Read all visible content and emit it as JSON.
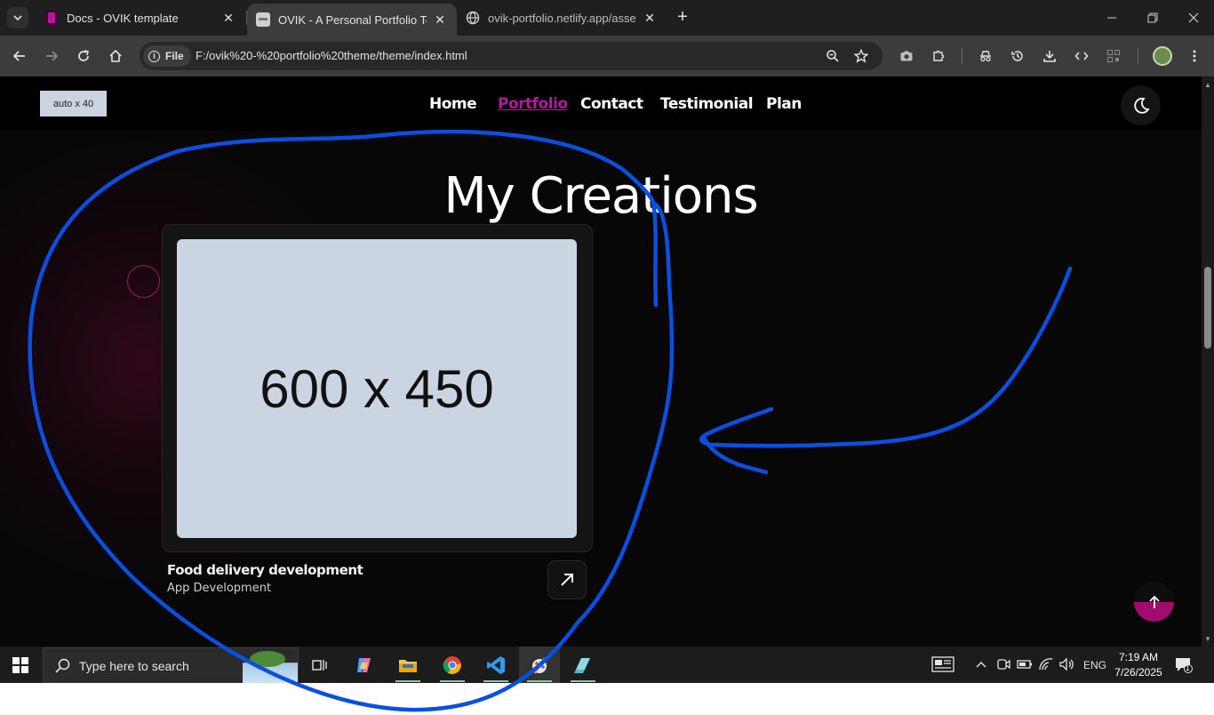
{
  "browser": {
    "tabs": [
      {
        "title": "Docs - OVIK template",
        "favicon": "ovik-docs-icon",
        "active": false
      },
      {
        "title": "OVIK - A Personal Portfolio Tem",
        "favicon": "ovik-page-icon",
        "active": true
      },
      {
        "title": "ovik-portfolio.netlify.app/assets",
        "favicon": "globe-icon",
        "active": false
      }
    ],
    "address": {
      "scheme_chip": "File",
      "url": "F:/ovik%20-%20portfolio%20theme/theme/index.html"
    }
  },
  "page": {
    "logo_placeholder": "auto x 40",
    "nav": [
      {
        "label": "Home",
        "active": false
      },
      {
        "label": "Portfolio",
        "active": true
      },
      {
        "label": "Contact",
        "active": false
      },
      {
        "label": "Testimonial",
        "active": false
      },
      {
        "label": "Plan",
        "active": false
      }
    ],
    "section_title": "My Creations",
    "project": {
      "image_placeholder": "600 x 450",
      "title": "Food delivery development",
      "category": "App Development"
    },
    "accent_color": "#b5179e",
    "scroll_top_fill": 0.5
  },
  "taskbar": {
    "search_placeholder": "Type here to search",
    "language": "ENG",
    "time": "7:19 AM",
    "date": "7/26/2025",
    "notification_count": "1"
  },
  "annotation": {
    "color": "#0a4fe0",
    "shapes": [
      "hand-drawn-loop",
      "hand-drawn-arrow"
    ]
  }
}
